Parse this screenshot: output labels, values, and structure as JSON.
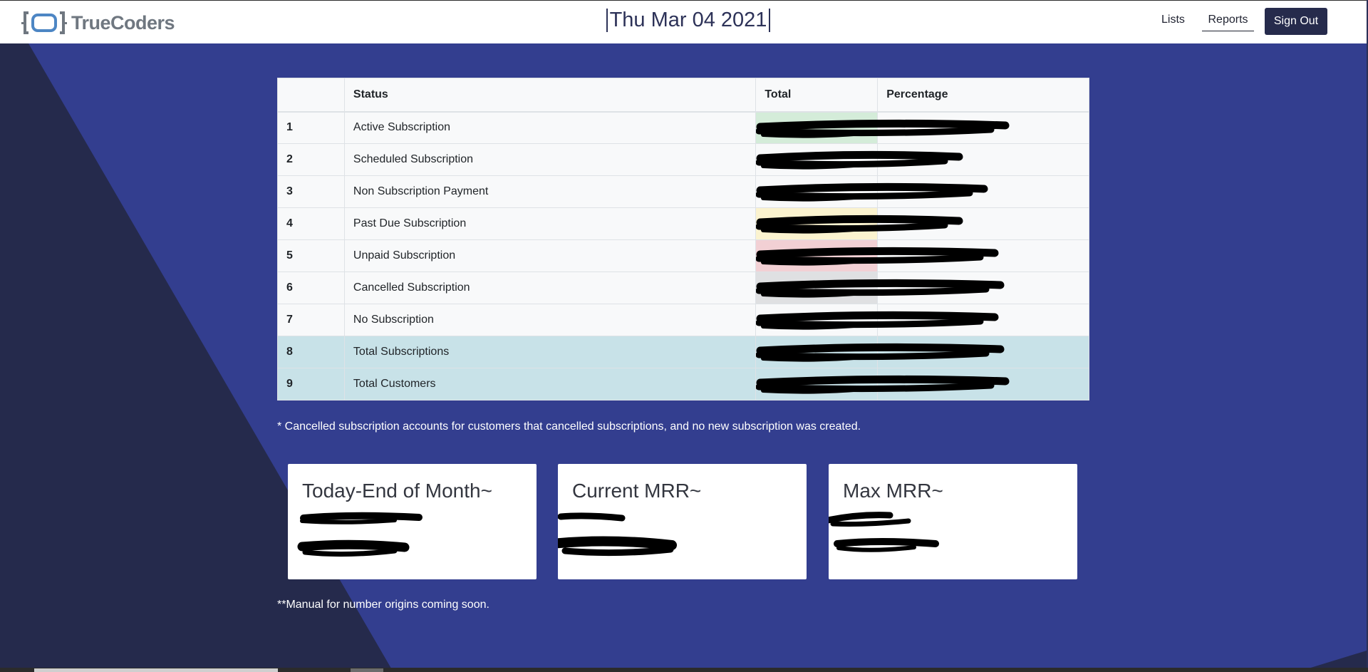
{
  "header": {
    "logo_text": "TrueCoders",
    "date": "Thu Mar 04 2021",
    "nav": {
      "lists": "Lists",
      "reports": "Reports",
      "signout": "Sign Out"
    }
  },
  "table": {
    "headers": [
      "",
      "Status",
      "Total",
      "Percentage"
    ],
    "rows": [
      {
        "index": "1",
        "status": "Active Subscription",
        "highlight": "#d4ecd9"
      },
      {
        "index": "2",
        "status": "Scheduled Subscription",
        "highlight": null
      },
      {
        "index": "3",
        "status": "Non Subscription Payment",
        "highlight": null
      },
      {
        "index": "4",
        "status": "Past Due Subscription",
        "highlight": "#fbf3cf"
      },
      {
        "index": "5",
        "status": "Unpaid Subscription",
        "highlight": "#f2d0d4"
      },
      {
        "index": "6",
        "status": "Cancelled Subscription",
        "highlight": "#dfe0e2"
      },
      {
        "index": "7",
        "status": "No Subscription",
        "highlight": null
      },
      {
        "index": "8",
        "status": "Total Subscriptions",
        "highlight": null,
        "total": true
      },
      {
        "index": "9",
        "status": "Total Customers",
        "highlight": null,
        "total": true
      }
    ]
  },
  "note_cancelled": "* Cancelled subscription accounts for customers that cancelled subscriptions, and no new subscription was created.",
  "cards": [
    {
      "title": "Today-End of Month~"
    },
    {
      "title": "Current MRR~"
    },
    {
      "title": "Max MRR~"
    }
  ],
  "note_manual": "**Manual for number origins coming soon.",
  "colors": {
    "navy": "#2d3258",
    "blue_bg": "#333e8f",
    "dark_bg": "#252a4c",
    "signout_bg": "#262b4c",
    "total_row": "#c8e2e8"
  }
}
